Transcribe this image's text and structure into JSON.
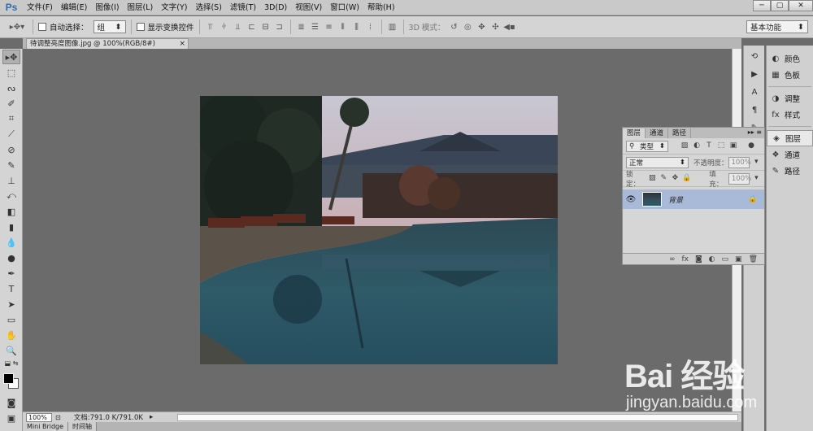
{
  "app": {
    "logo": "Ps"
  },
  "menu": [
    "文件(F)",
    "编辑(E)",
    "图像(I)",
    "图层(L)",
    "文字(Y)",
    "选择(S)",
    "滤镜(T)",
    "3D(D)",
    "视图(V)",
    "窗口(W)",
    "帮助(H)"
  ],
  "window_controls": {
    "minimize": "─",
    "maximize": "▢",
    "close": "✕"
  },
  "options": {
    "auto_select_label": "自动选择：",
    "auto_select_value": "组",
    "show_transform_label": "显示变换控件",
    "mode_3d_label": "3D 模式：",
    "workspace": "基本功能"
  },
  "document": {
    "tab_title": "待调整亮度图像.jpg @ 100%(RGB/8#)",
    "tab_close": "×"
  },
  "status": {
    "zoom": "100%",
    "doc_size": "文档:791.0 K/791.0K"
  },
  "bottom_tabs": [
    "Mini Bridge",
    "时间轴"
  ],
  "dock": {
    "items": [
      {
        "icon": "palette-icon",
        "glyph": "◐",
        "label": "颜色"
      },
      {
        "icon": "swatches-icon",
        "glyph": "▦",
        "label": "色板"
      },
      {
        "icon": "adjustments-icon",
        "glyph": "◑",
        "label": "调整"
      },
      {
        "icon": "styles-icon",
        "glyph": "fx",
        "label": "样式"
      },
      {
        "icon": "layers-icon",
        "glyph": "◈",
        "label": "图层"
      },
      {
        "icon": "channels-icon",
        "glyph": "❖",
        "label": "通道"
      },
      {
        "icon": "paths-icon",
        "glyph": "✎",
        "label": "路径"
      }
    ]
  },
  "layers_panel": {
    "tabs": [
      "图层",
      "通道",
      "路径"
    ],
    "menu_glyph": "▸▸ ≡",
    "filter_kind": "类型",
    "blend_mode": "正常",
    "opacity_label": "不透明度：",
    "opacity_value": "100%",
    "lock_label": "锁定：",
    "fill_label": "填充：",
    "fill_value": "100%",
    "layer_name": "背景",
    "footer_icons": [
      "∞",
      "fx",
      "◙",
      "◐",
      "▭",
      "▣",
      "🗑"
    ]
  },
  "watermark": {
    "logo": "Bai 经验",
    "url": "jingyan.baidu.com"
  }
}
